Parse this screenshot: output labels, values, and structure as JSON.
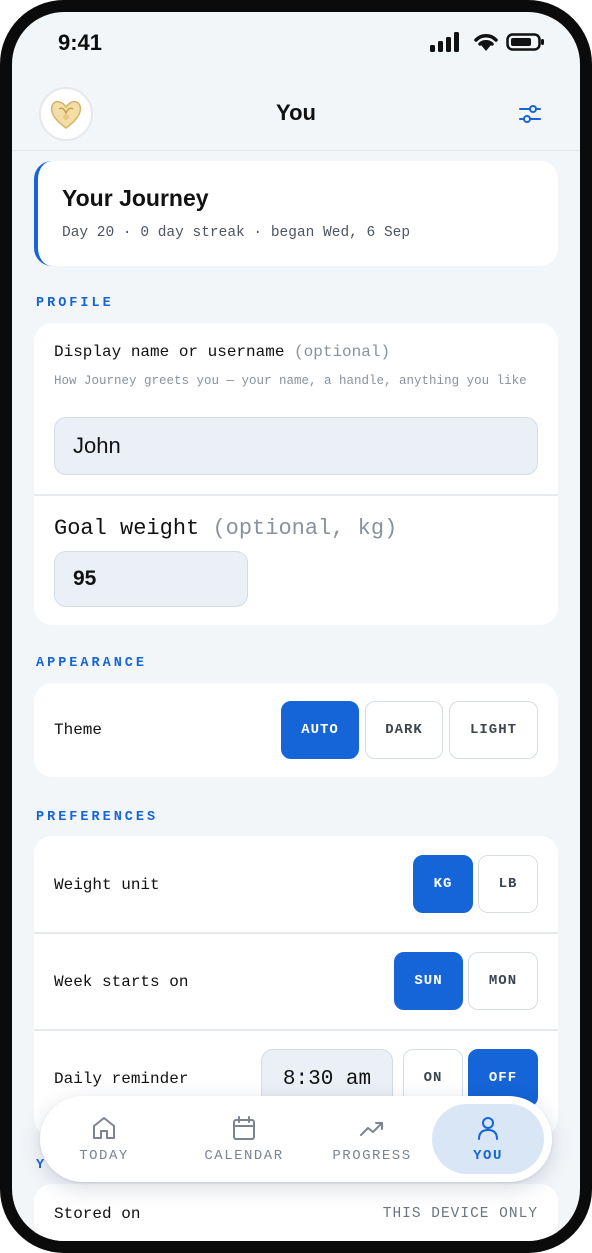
{
  "status_bar": {
    "time": "9:41"
  },
  "header": {
    "title": "You"
  },
  "journey": {
    "title": "Your Journey",
    "subtitle": "Day 20 · 0 day streak · began Wed, 6 Sep"
  },
  "profile": {
    "section_label": "PROFILE",
    "display_name_label": "Display name or username",
    "display_name_optional": "(optional)",
    "display_name_hint": "How Journey greets you — your name, a handle, anything you like",
    "display_name_value": "John",
    "goal_weight_label": "Goal weight",
    "goal_weight_optional": "(optional, kg)",
    "goal_weight_value": "95"
  },
  "appearance": {
    "section_label": "APPEARANCE",
    "theme_label": "Theme",
    "theme_options": [
      "AUTO",
      "DARK",
      "LIGHT"
    ],
    "theme_selected": "AUTO"
  },
  "preferences": {
    "section_label": "PREFERENCES",
    "weight_unit_label": "Weight unit",
    "weight_unit_options": [
      "KG",
      "LB"
    ],
    "weight_unit_selected": "KG",
    "week_start_label": "Week starts on",
    "week_start_options": [
      "SUN",
      "MON"
    ],
    "week_start_selected": "SUN",
    "reminder_label": "Daily reminder",
    "reminder_time": "8:30 am",
    "reminder_options": [
      "ON",
      "OFF"
    ],
    "reminder_selected": "OFF"
  },
  "data_section": {
    "section_label_partial": "Y",
    "stored_on_label": "Stored on",
    "stored_on_value": "THIS DEVICE ONLY"
  },
  "tab_bar": {
    "tabs": [
      {
        "label": "TODAY",
        "icon": "home-icon"
      },
      {
        "label": "CALENDAR",
        "icon": "calendar-icon"
      },
      {
        "label": "PROGRESS",
        "icon": "trending-up-icon"
      },
      {
        "label": "YOU",
        "icon": "person-icon"
      }
    ],
    "active": "YOU"
  },
  "colors": {
    "accent": "#1565d8",
    "background": "#f3f6f9",
    "card": "#ffffff",
    "input_fill": "#eaf0f6",
    "muted_text": "#8a929c"
  }
}
